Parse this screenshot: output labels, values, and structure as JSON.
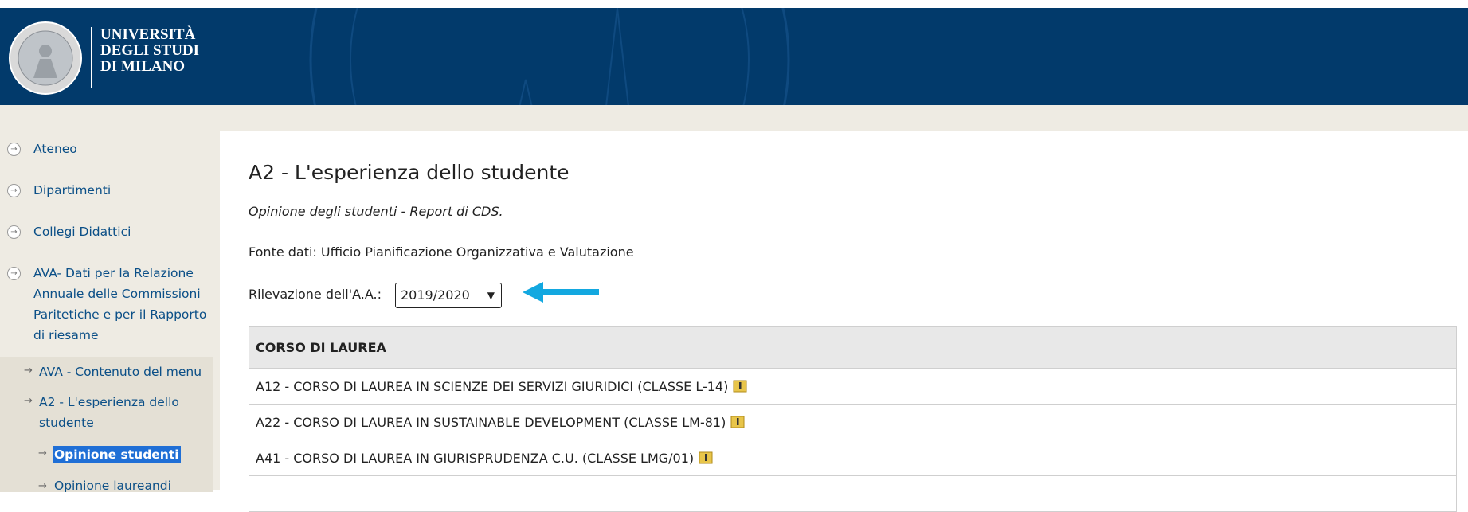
{
  "university": {
    "line1": "UNIVERSITÀ",
    "line2": "DEGLI STUDI",
    "line3": "DI MILANO"
  },
  "sidebar": {
    "items": [
      {
        "label": "Ateneo"
      },
      {
        "label": "Dipartimenti"
      },
      {
        "label": "Collegi Didattici"
      },
      {
        "label": "AVA- Dati per la Relazione Annuale delle Commissioni Paritetiche e per il Rapporto di riesame"
      }
    ],
    "sub_items": [
      {
        "label": "AVA - Contenuto del menu"
      },
      {
        "label": "A2 - L'esperienza dello studente"
      }
    ],
    "sub_sub_items": [
      {
        "label": "Opinione studenti",
        "active": true
      },
      {
        "label": "Opinione laureandi"
      }
    ]
  },
  "main": {
    "title": "A2 - L'esperienza dello studente",
    "subtitle": "Opinione degli studenti - Report di CDS.",
    "source": "Fonte dati: Ufficio Pianificazione Organizzativa e Valutazione",
    "year_label": "Rilevazione dell'A.A.:",
    "year_value": "2019/2020",
    "table_header": "CORSO DI LAUREA",
    "rows": [
      "A12 - CORSO DI LAUREA IN SCIENZE DEI SERVIZI GIURIDICI (CLASSE L-14)",
      "A22 - CORSO DI LAUREA IN SUSTAINABLE DEVELOPMENT (CLASSE LM-81)",
      "A41 - CORSO DI LAUREA IN GIURISPRUDENZA C.U. (CLASSE LMG/01)"
    ]
  },
  "colors": {
    "header_bg": "#023a6b",
    "sidebar_bg": "#eeebe3",
    "link": "#0b4f87",
    "active_bg": "#1f6fd6",
    "arrow": "#13a8e0"
  }
}
